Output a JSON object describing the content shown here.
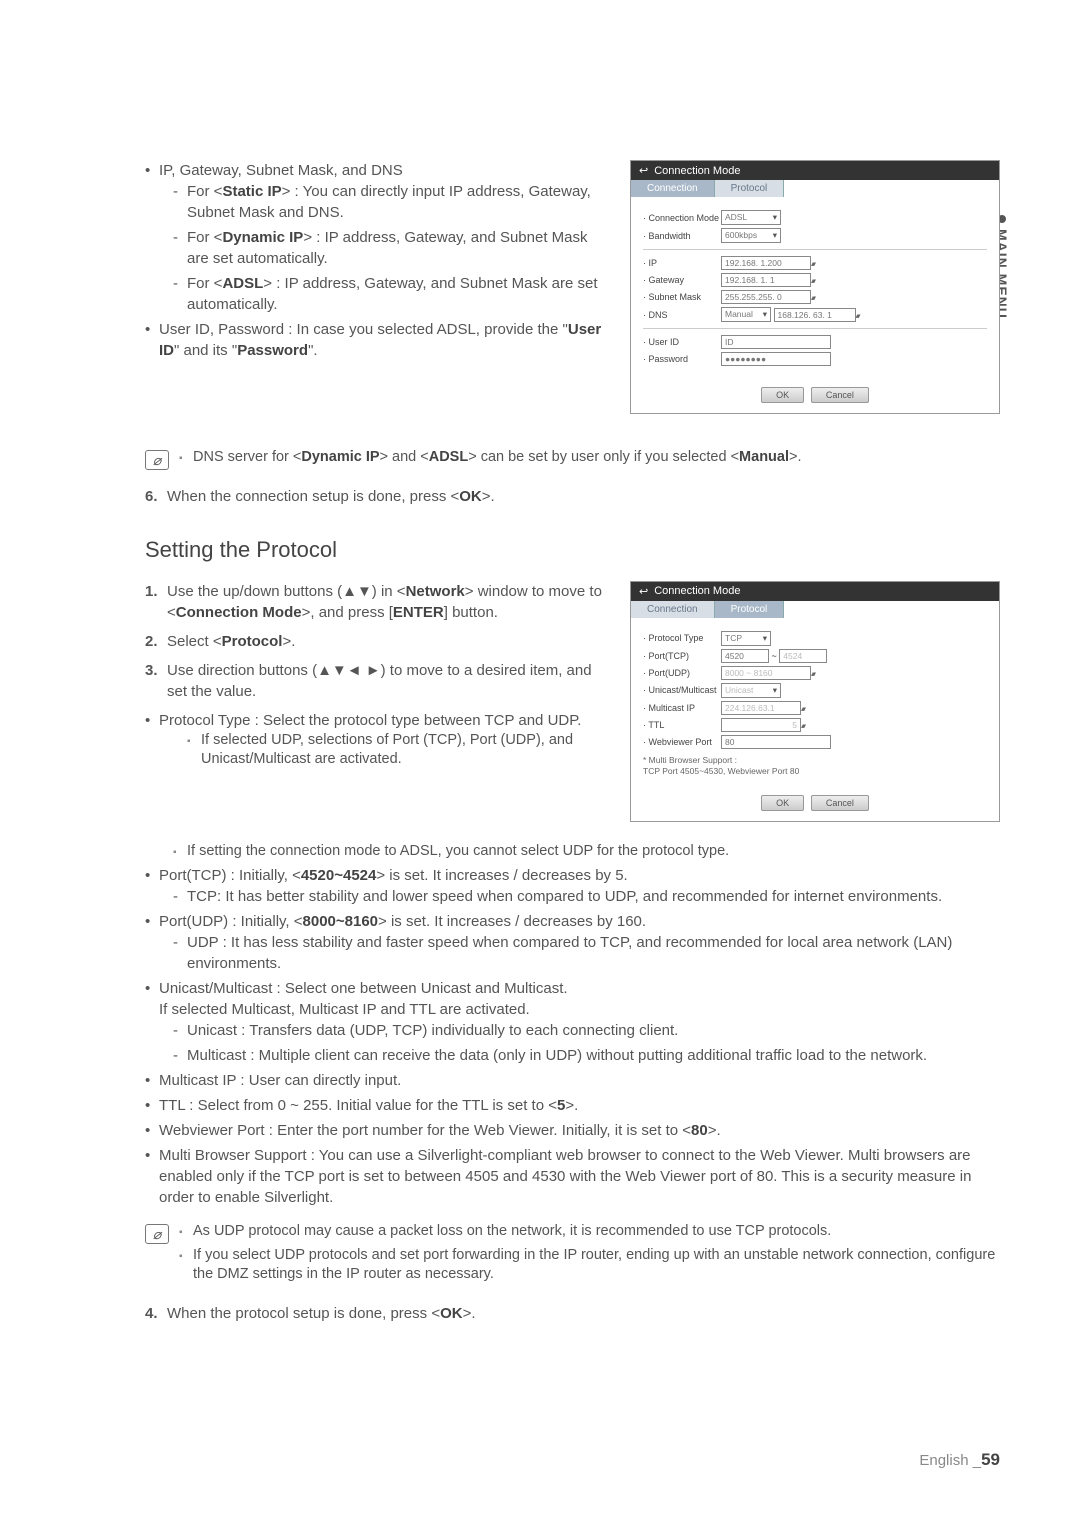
{
  "sideTab": "MAIN MENU",
  "section1": {
    "b1": "IP, Gateway, Subnet Mask, and DNS",
    "d1_pre": "For <",
    "d1_b": "Static IP",
    "d1_post": "> : You can directly input IP address, Gateway, Subnet Mask and DNS.",
    "d2_pre": "For <",
    "d2_b": "Dynamic IP",
    "d2_post": "> : IP address, Gateway, and Subnet Mask are set automatically.",
    "d3_pre": "For <",
    "d3_b": "ADSL",
    "d3_post": "> : IP address, Gateway, and Subnet Mask are set automatically.",
    "b2_pre": "User ID, Password : In case you selected ADSL, provide the \"",
    "b2_b1": "User ID",
    "b2_mid": "\" and its \"",
    "b2_b2": "Password",
    "b2_post": "\"."
  },
  "note1": {
    "t1": "DNS server for <",
    "b1": "Dynamic IP",
    "t2": "> and <",
    "b2": "ADSL",
    "t3": "> can be set by user only if you selected <",
    "b3": "Manual",
    "t4": ">."
  },
  "step6": {
    "num": "6.",
    "t1": "When the connection setup is done, press <",
    "b": "OK",
    "t2": ">."
  },
  "heading": "Setting the Protocol",
  "steps": {
    "s1": {
      "num": "1.",
      "t1": "Use the up/down buttons (▲▼) in <",
      "b1": "Network",
      "t2": "> window to move to <",
      "b2": "Connection Mode",
      "t3": ">, and press [",
      "b3": "ENTER",
      "t4": "] button."
    },
    "s2": {
      "num": "2.",
      "t1": "Select <",
      "b": "Protocol",
      "t2": ">."
    },
    "s3": {
      "num": "3.",
      "t": "Use direction buttons (▲▼◄ ►) to move to a desired item, and set the value."
    }
  },
  "proto": {
    "b1": "Protocol Type : Select the protocol type between TCP and UDP.",
    "sq1": "If selected UDP, selections of Port (TCP), Port (UDP), and Unicast/Multicast are activated.",
    "sq2": "If setting the connection mode to ADSL, you cannot select UDP for the protocol type.",
    "b2_t1": "Port(TCP) : Initially, <",
    "b2_b": "4520~4524",
    "b2_t2": "> is set. It increases / decreases by 5.",
    "b2_d": "TCP: It has better stability and lower speed when compared to UDP, and recommended for internet environments.",
    "b3_t1": "Port(UDP) : Initially, <",
    "b3_b": "8000~8160",
    "b3_t2": "> is set. It increases / decreases by 160.",
    "b3_d": "UDP : It has less stability and faster speed when compared to TCP, and recommended for local area network (LAN) environments.",
    "b4a": "Unicast/Multicast : Select one between Unicast and Multicast.",
    "b4b": "If selected Multicast, Multicast IP and TTL are activated.",
    "b4_d1": "Unicast : Transfers data (UDP, TCP) individually to each connecting client.",
    "b4_d2": "Multicast : Multiple client can receive the data (only in UDP) without putting additional traffic load to the network.",
    "b5": "Multicast IP : User can directly input.",
    "b6_t1": "TTL : Select from 0 ~ 255. Initial value for the TTL is set to <",
    "b6_b": "5",
    "b6_t2": ">.",
    "b7_t1": "Webviewer Port : Enter the port number for the Web Viewer. Initially, it is set to <",
    "b7_b": "80",
    "b7_t2": ">.",
    "b8": "Multi Browser Support : You can use a Silverlight-compliant web browser to connect to the Web Viewer. Multi browsers are enabled only if the TCP port is set to between 4505 and 4530 with the Web Viewer port of 80. This is a security measure in order to enable Silverlight."
  },
  "note2": {
    "sq1": "As UDP protocol may cause a packet loss on the network, it is recommended to use TCP protocols.",
    "sq2": "If you select UDP protocols and set port forwarding in the IP router, ending up with an unstable network connection, configure the DMZ settings in the IP router as necessary."
  },
  "step4": {
    "num": "4.",
    "t1": "When the protocol setup is done, press <",
    "b": "OK",
    "t2": ">."
  },
  "ss1": {
    "title": "Connection Mode",
    "tab1": "Connection",
    "tab2": "Protocol",
    "r1l": "Connection Mode",
    "r1v": "ADSL",
    "r2l": "Bandwidth",
    "r2v": "600kbps",
    "r3l": "IP",
    "r3v": "192.168. 1.200",
    "r4l": "Gateway",
    "r4v": "192.168. 1. 1",
    "r5l": "Subnet Mask",
    "r5v": "255.255.255. 0",
    "r6l": "DNS",
    "r6v1": "Manual",
    "r6v2": "168.126. 63. 1",
    "r7l": "User ID",
    "r7v": "ID",
    "r8l": "Password",
    "r8v": "●●●●●●●●",
    "ok": "OK",
    "cancel": "Cancel"
  },
  "ss2": {
    "title": "Connection Mode",
    "tab1": "Connection",
    "tab2": "Protocol",
    "r1l": "Protocol Type",
    "r1v": "TCP",
    "r2l": "Port(TCP)",
    "r2v1": "4520",
    "r2sep": "~",
    "r2v2": "4524",
    "r3l": "Port(UDP)",
    "r3v": "8000 ~ 8160",
    "r4l": "Unicast/Multicast",
    "r4v": "Unicast",
    "r5l": "Multicast IP",
    "r5v": "224.126.63.1",
    "r6l": "TTL",
    "r6v": "5",
    "r7l": "Webviewer Port",
    "r7v": "80",
    "note1": "* Multi Browser Support :",
    "note2": "  TCP Port 4505~4530, Webviewer Port 80",
    "ok": "OK",
    "cancel": "Cancel"
  },
  "footer": {
    "lang": "English _",
    "page": "59"
  }
}
